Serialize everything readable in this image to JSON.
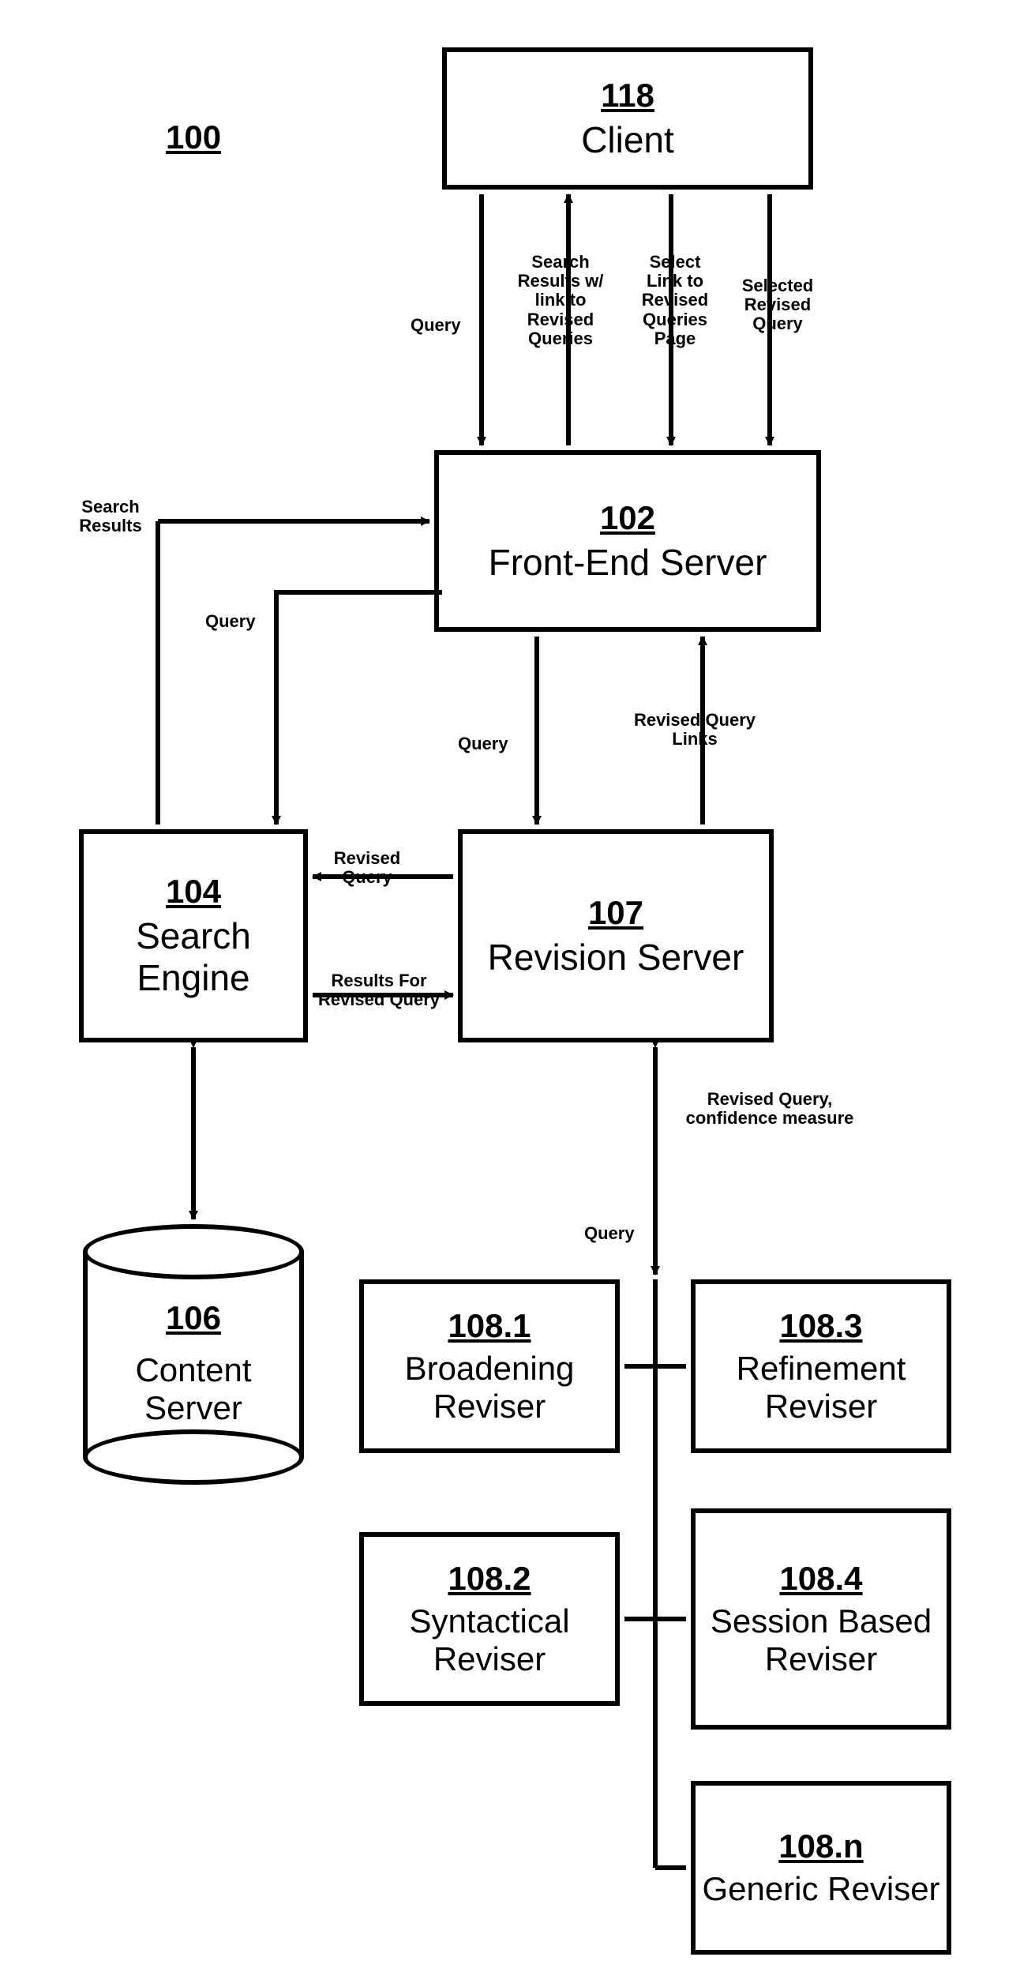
{
  "diagram_num": "100",
  "client": {
    "num": "118",
    "name": "Client"
  },
  "front_end": {
    "num": "102",
    "name": "Front-End Server"
  },
  "search_engine": {
    "num": "104",
    "name": "Search Engine"
  },
  "revision_server": {
    "num": "107",
    "name": "Revision Server"
  },
  "content_server": {
    "num": "106",
    "name": "Content Server"
  },
  "revisers": [
    {
      "num": "108.1",
      "name": "Broadening Reviser"
    },
    {
      "num": "108.3",
      "name": "Refinement Reviser"
    },
    {
      "num": "108.2",
      "name": "Syntactical Reviser"
    },
    {
      "num": "108.4",
      "name": "Session Based Reviser"
    },
    {
      "num": "108.n",
      "name": "Generic Reviser"
    }
  ],
  "labels": {
    "query": "Query",
    "search_results_link": "Search Results w/ link to Revised Queries",
    "select_link": "Select Link to Revised Queries Page",
    "selected_revised": "Selected Revised Query",
    "search_results": "Search Results",
    "revised_query": "Revised Query",
    "results_for_revised": "Results For Revised Query",
    "revised_query_links": "Revised Query Links",
    "revised_query_conf": "Revised Query, confidence measure"
  }
}
